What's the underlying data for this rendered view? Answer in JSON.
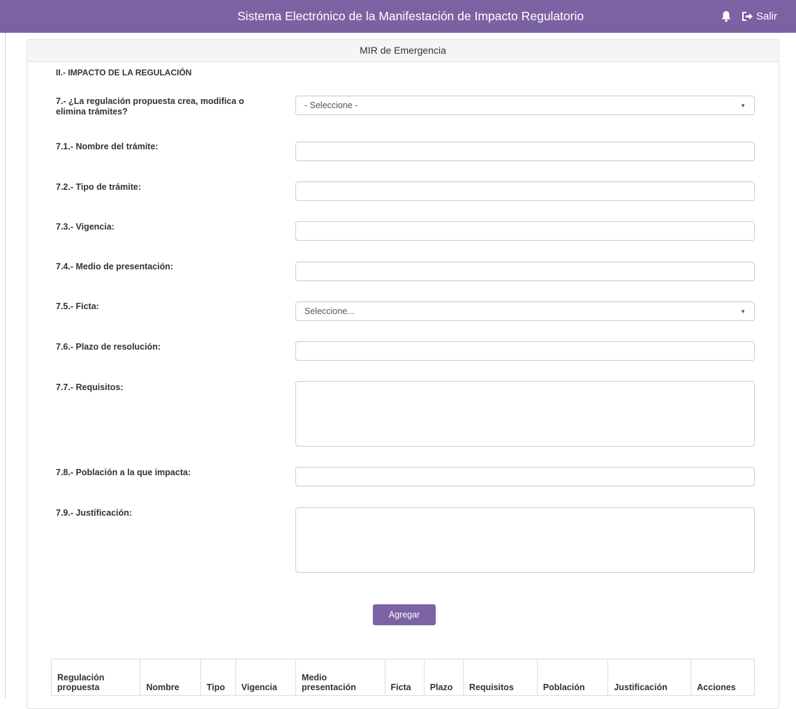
{
  "header": {
    "system_title": "Sistema Electrónico de la Manifestación de Impacto Regulatorio",
    "logout_label": "Salir",
    "bg_color": "#7b62a3"
  },
  "panel": {
    "title": "MIR de Emergencia",
    "section_title": "II.- IMPACTO DE LA REGULACIÓN"
  },
  "form": {
    "q7": {
      "label": "7.- ¿La regulación propuesta crea, modifica o elimina trámites?",
      "value": "- Seleccione -"
    },
    "q7_1": {
      "label": "7.1.- Nombre del trámite:",
      "value": ""
    },
    "q7_2": {
      "label": "7.2.- Tipo de trámite:",
      "value": ""
    },
    "q7_3": {
      "label": "7.3.- Vigencia:",
      "value": ""
    },
    "q7_4": {
      "label": "7.4.- Medio de presentación:",
      "value": ""
    },
    "q7_5": {
      "label": "7.5.- Ficta:",
      "value": "Seleccione..."
    },
    "q7_6": {
      "label": "7.6.- Plazo de resolución:",
      "value": ""
    },
    "q7_7": {
      "label": "7.7.- Requisitos:",
      "value": ""
    },
    "q7_8": {
      "label": "7.8.- Población a la que impacta:",
      "value": ""
    },
    "q7_9": {
      "label": "7.9.- Justificación:",
      "value": ""
    },
    "add_button": "Agregar"
  },
  "table": {
    "headers": [
      "Regulación propuesta",
      "Nombre",
      "Tipo",
      "Vigencia",
      "Medio presentación",
      "Ficta",
      "Plazo",
      "Requisitos",
      "Población",
      "Justificación",
      "Acciones"
    ]
  }
}
